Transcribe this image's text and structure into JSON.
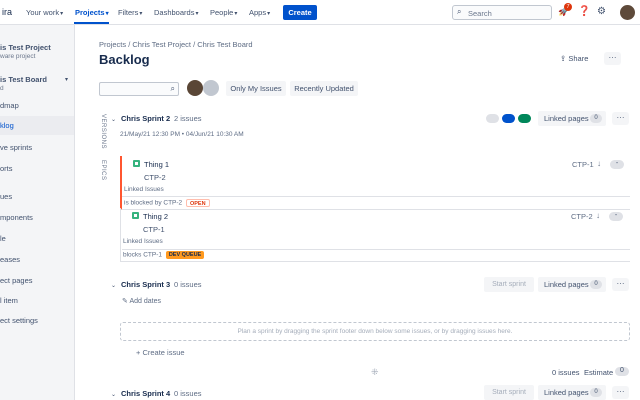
{
  "nav": {
    "logo": "ira",
    "items": [
      "Your work",
      "Projects",
      "Filters",
      "Dashboards",
      "People",
      "Apps"
    ],
    "create": "Create",
    "search_placeholder": "Search",
    "notification_count": "7"
  },
  "sidebar": {
    "project_name": "is Test Project",
    "project_sub": "ware project",
    "board_name": "is Test Board",
    "board_sub": "d",
    "items": [
      "dmap",
      "klog",
      "ve sprints",
      "orts",
      "ues",
      "mponents",
      "le",
      "eases",
      "ect pages",
      "l item",
      "ect settings"
    ]
  },
  "breadcrumb": [
    "Projects",
    "Chris Test Project",
    "Chris Test Board"
  ],
  "page_title": "Backlog",
  "share": "Share",
  "filters": {
    "only_my_issues": "Only My Issues",
    "recently_updated": "Recently Updated"
  },
  "side_tabs": [
    "VERSIONS",
    "EPICS"
  ],
  "sprints": [
    {
      "name": "Chris Sprint 2",
      "count": "2 issues",
      "dates": "21/May/21 12:30 PM • 04/Jun/21 10:30 AM",
      "linked_pages": "Linked pages",
      "linked_count": "0",
      "status_colors": [
        "#dfe1e6",
        "#0052cc",
        "#00875a"
      ]
    },
    {
      "name": "Chris Sprint 3",
      "count": "0 issues",
      "start": "Start sprint",
      "linked_pages": "Linked pages",
      "linked_count": "0",
      "add_dates": "Add dates",
      "dropzone": "Plan a sprint by dragging the sprint footer down below some issues, or by dragging issues here.",
      "create_issue": "+ Create issue",
      "footer_issues": "0 issues",
      "estimate_label": "Estimate",
      "estimate_value": "0"
    },
    {
      "name": "Chris Sprint 4",
      "count": "0 issues",
      "start": "Start sprint",
      "linked_pages": "Linked pages",
      "linked_count": "0"
    }
  ],
  "issues": [
    {
      "summary": "Thing 1",
      "key": "CTP-1",
      "linked_key": "CTP-2",
      "linked_label": "Linked Issues",
      "link_text": "is blocked by CTP-2",
      "status": "OPEN",
      "pill": "-"
    },
    {
      "summary": "Thing 2",
      "key": "CTP-2",
      "linked_key": "CTP-1",
      "linked_label": "Linked Issues",
      "link_text": "blocks CTP-1",
      "status": "DEV QUEUE",
      "pill": "-"
    }
  ]
}
